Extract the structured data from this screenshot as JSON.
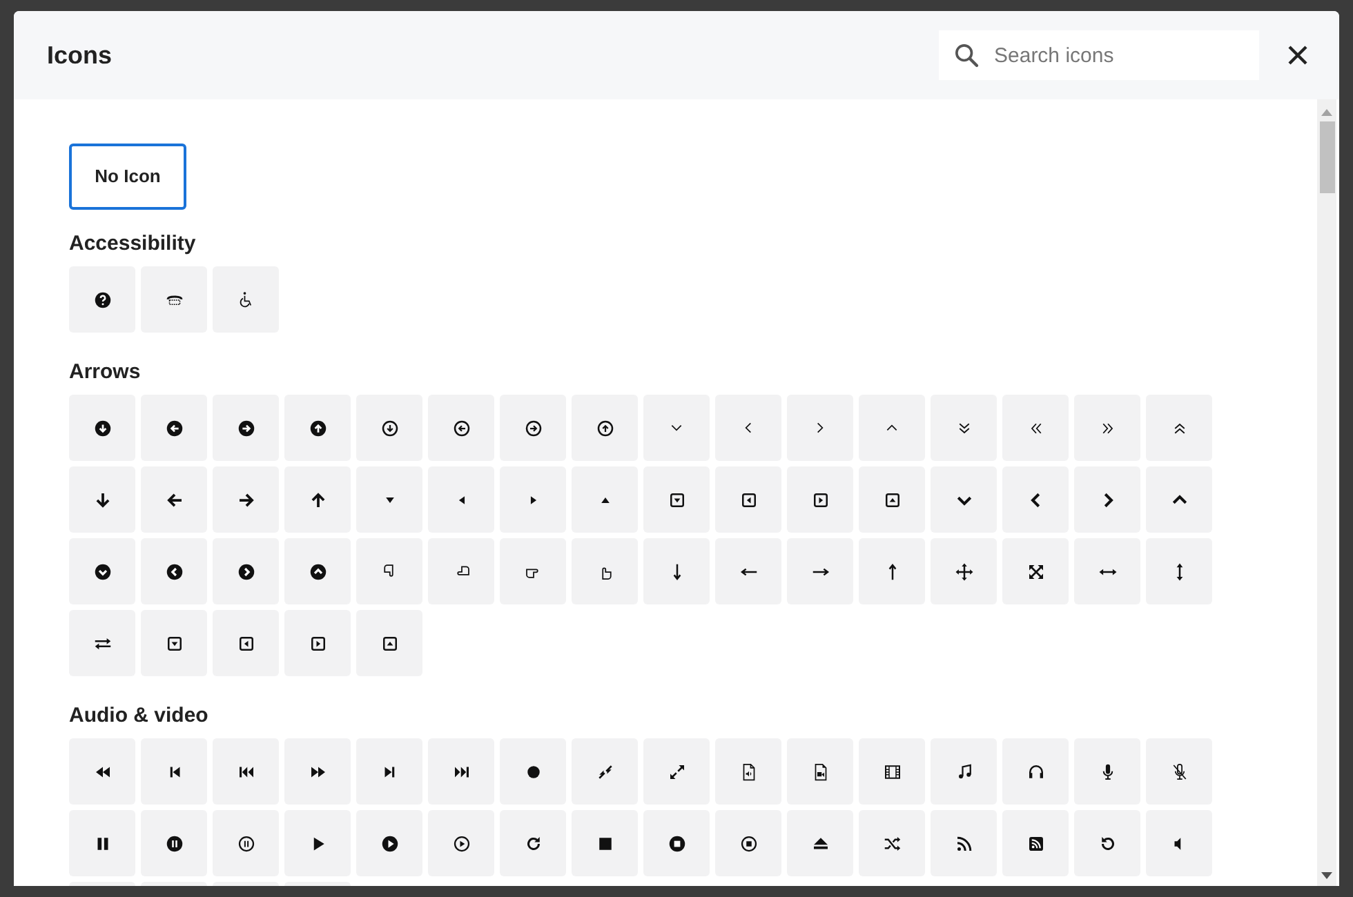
{
  "dialog": {
    "title": "Icons",
    "search": {
      "placeholder": "Search icons"
    },
    "no_icon_button": {
      "label": "No Icon",
      "selected": true
    },
    "sections": [
      {
        "title": "Accessibility"
      },
      {
        "title": "Arrows"
      },
      {
        "title": "Audio & video"
      }
    ]
  }
}
